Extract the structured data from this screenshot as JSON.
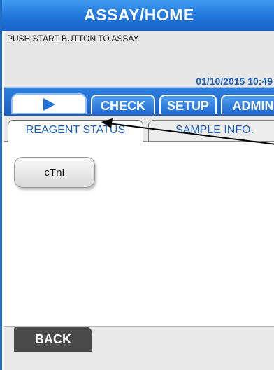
{
  "header": {
    "title": "ASSAY/HOME"
  },
  "message": {
    "text": "PUSH START BUTTON TO ASSAY.",
    "datetime": "01/10/2015 10:49"
  },
  "tabs": {
    "play_icon": "play-icon",
    "check": "CHECK",
    "setup": "SETUP",
    "admin": "ADMIN"
  },
  "subtabs": {
    "reagent": "REAGENT STATUS",
    "sample": "SAMPLE INFO."
  },
  "reagents": [
    {
      "label": "cTnI"
    }
  ],
  "footer": {
    "back": "BACK"
  },
  "colors": {
    "header_blue": "#1e72d8",
    "accent_text": "#1a5fc0",
    "back_button": "#4a4a4a"
  }
}
